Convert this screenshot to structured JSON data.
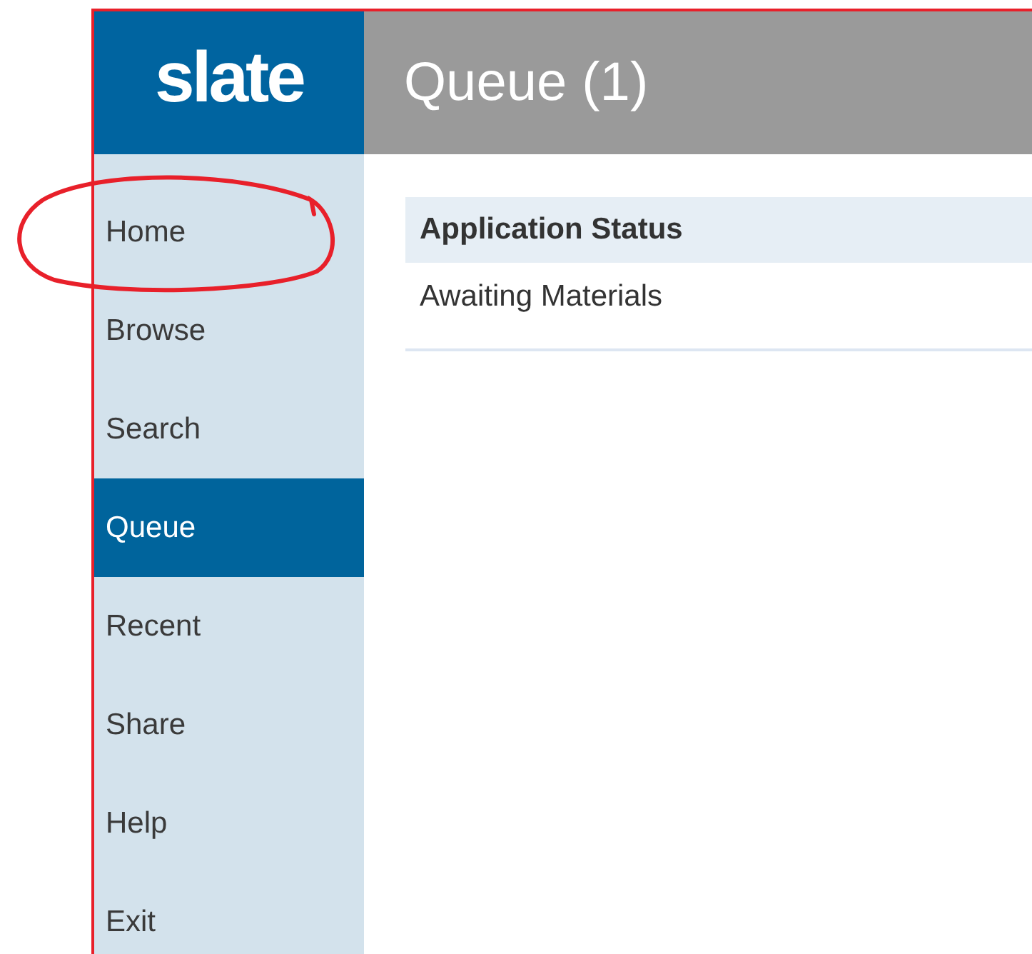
{
  "logo": "slate",
  "header": {
    "title": "Queue (1)"
  },
  "sidebar": {
    "items": [
      {
        "label": "Home",
        "selected": false,
        "circled": true
      },
      {
        "label": "Browse",
        "selected": false,
        "circled": false
      },
      {
        "label": "Search",
        "selected": false,
        "circled": false
      },
      {
        "label": "Queue",
        "selected": true,
        "circled": false
      },
      {
        "label": "Recent",
        "selected": false,
        "circled": false
      },
      {
        "label": "Share",
        "selected": false,
        "circled": false
      },
      {
        "label": "Help",
        "selected": false,
        "circled": false
      },
      {
        "label": "Exit",
        "selected": false,
        "circled": false
      }
    ]
  },
  "table": {
    "columns": [
      "Application Status"
    ],
    "rows": [
      [
        "Awaiting Materials"
      ]
    ]
  }
}
